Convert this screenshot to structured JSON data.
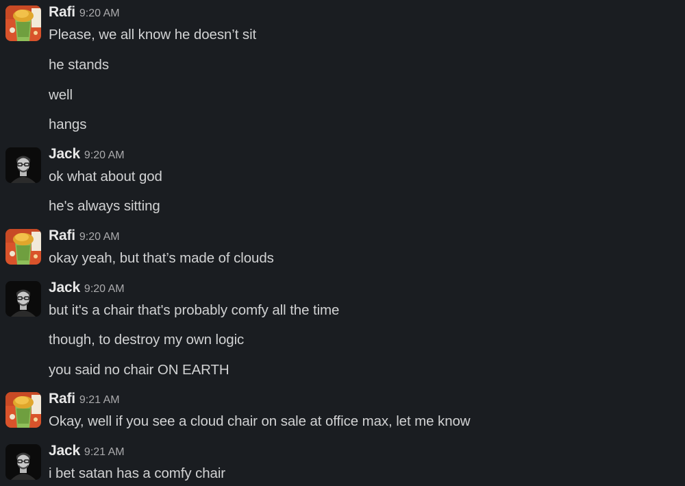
{
  "messages": [
    {
      "author": "Rafi",
      "time": "9:20 AM",
      "avatar": "rafi-drink-avatar",
      "lines": [
        "Please, we all know he doesn’t sit",
        "he stands",
        "well",
        "hangs"
      ]
    },
    {
      "author": "Jack",
      "time": "9:20 AM",
      "avatar": "jack-portrait-avatar",
      "lines": [
        "ok what about god",
        "he's always sitting"
      ]
    },
    {
      "author": "Rafi",
      "time": "9:20 AM",
      "avatar": "rafi-drink-avatar",
      "lines": [
        "okay yeah, but that’s made of clouds"
      ]
    },
    {
      "author": "Jack",
      "time": "9:20 AM",
      "avatar": "jack-portrait-avatar",
      "lines": [
        "but it's a chair that's probably comfy all the time",
        "though, to destroy my own logic",
        "you said no chair ON EARTH"
      ]
    },
    {
      "author": "Rafi",
      "time": "9:21 AM",
      "avatar": "rafi-drink-avatar",
      "lines": [
        "Okay, well if you see a cloud chair on sale at office max, let me know"
      ]
    },
    {
      "author": "Jack",
      "time": "9:21 AM",
      "avatar": "jack-portrait-avatar",
      "lines": [
        "i bet satan has a comfy chair"
      ]
    }
  ],
  "colors": {
    "background": "#1a1d21",
    "text": "#d1d2d3",
    "author": "#e8e8e8",
    "timestamp": "#ababad"
  }
}
